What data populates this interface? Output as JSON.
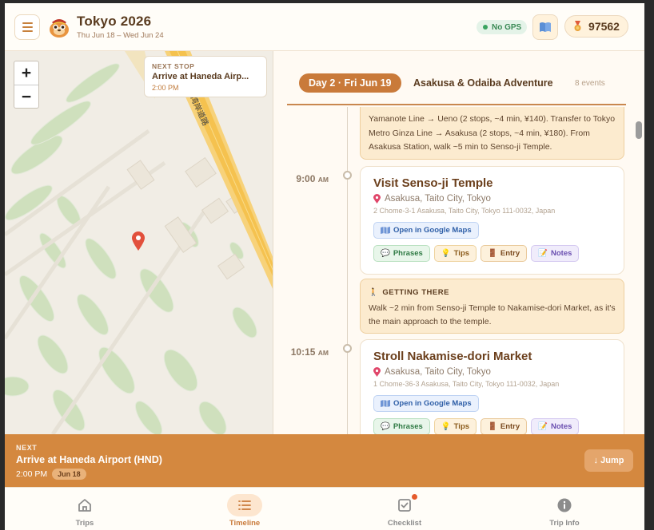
{
  "header": {
    "title": "Tokyo 2026",
    "dates": "Thu Jun 18 – Wed Jun 24",
    "gps_label": "No GPS",
    "points": "97562",
    "menu_icon": "hamburger-icon",
    "book_icon": "book-icon",
    "points_icon": "medal-icon"
  },
  "map": {
    "zoom_in": "+",
    "zoom_out": "−",
    "next_stop_label": "NEXT STOP",
    "next_stop_title": "Arrive at Haneda Airp...",
    "next_stop_time": "2:00 PM",
    "road_label": "湾岸道路"
  },
  "day": {
    "pill": "Day 2 · Fri Jun 19",
    "title": "Asakusa & Odaiba Adventure",
    "events": "8 events"
  },
  "timeline": {
    "top_transit_text": "Yamanote Line → Ueno (2 stops, ~4 min, ¥140). Transfer to Tokyo Metro Ginza Line → Asakusa (2 stops, ~4 min, ¥180). From Asakusa Station, walk ~5 min to Senso-ji Temple.",
    "events": [
      {
        "time": "9:00",
        "ampm": "AM",
        "name": "Visit Senso-ji Temple",
        "location": "Asakusa, Taito City, Tokyo",
        "address": "2 Chome-3-1 Asakusa, Taito City, Tokyo 111-0032, Japan",
        "maps_label": "Open in Google Maps",
        "tags": [
          "Phrases",
          "Tips",
          "Entry",
          "Notes"
        ]
      },
      {
        "time": "10:15",
        "ampm": "AM",
        "name": "Stroll Nakamise-dori Market",
        "location": "Asakusa, Taito City, Tokyo",
        "address": "1 Chome-36-3 Asakusa, Taito City, Tokyo 111-0032, Japan",
        "maps_label": "Open in Google Maps",
        "tags": [
          "Phrases",
          "Tips",
          "Entry",
          "Notes"
        ]
      }
    ],
    "getting_there": {
      "heading": "GETTING THERE",
      "text": "Walk ~2 min from Senso-ji Temple to Nakamise-dori Market, as it's the main approach to the temple."
    }
  },
  "next_banner": {
    "label": "NEXT",
    "title": "Arrive at Haneda Airport (HND)",
    "time": "2:00 PM",
    "date": "Jun 18",
    "jump_label": "↓ Jump"
  },
  "nav": {
    "items": [
      {
        "label": "Trips",
        "icon": "home-icon"
      },
      {
        "label": "Timeline",
        "icon": "list-icon"
      },
      {
        "label": "Checklist",
        "icon": "checklist-icon"
      },
      {
        "label": "Trip Info",
        "icon": "info-icon"
      }
    ],
    "active": "Timeline"
  },
  "colors": {
    "accent": "#c97a3a",
    "banner": "#d4883f",
    "gps_green": "#3aa460"
  }
}
